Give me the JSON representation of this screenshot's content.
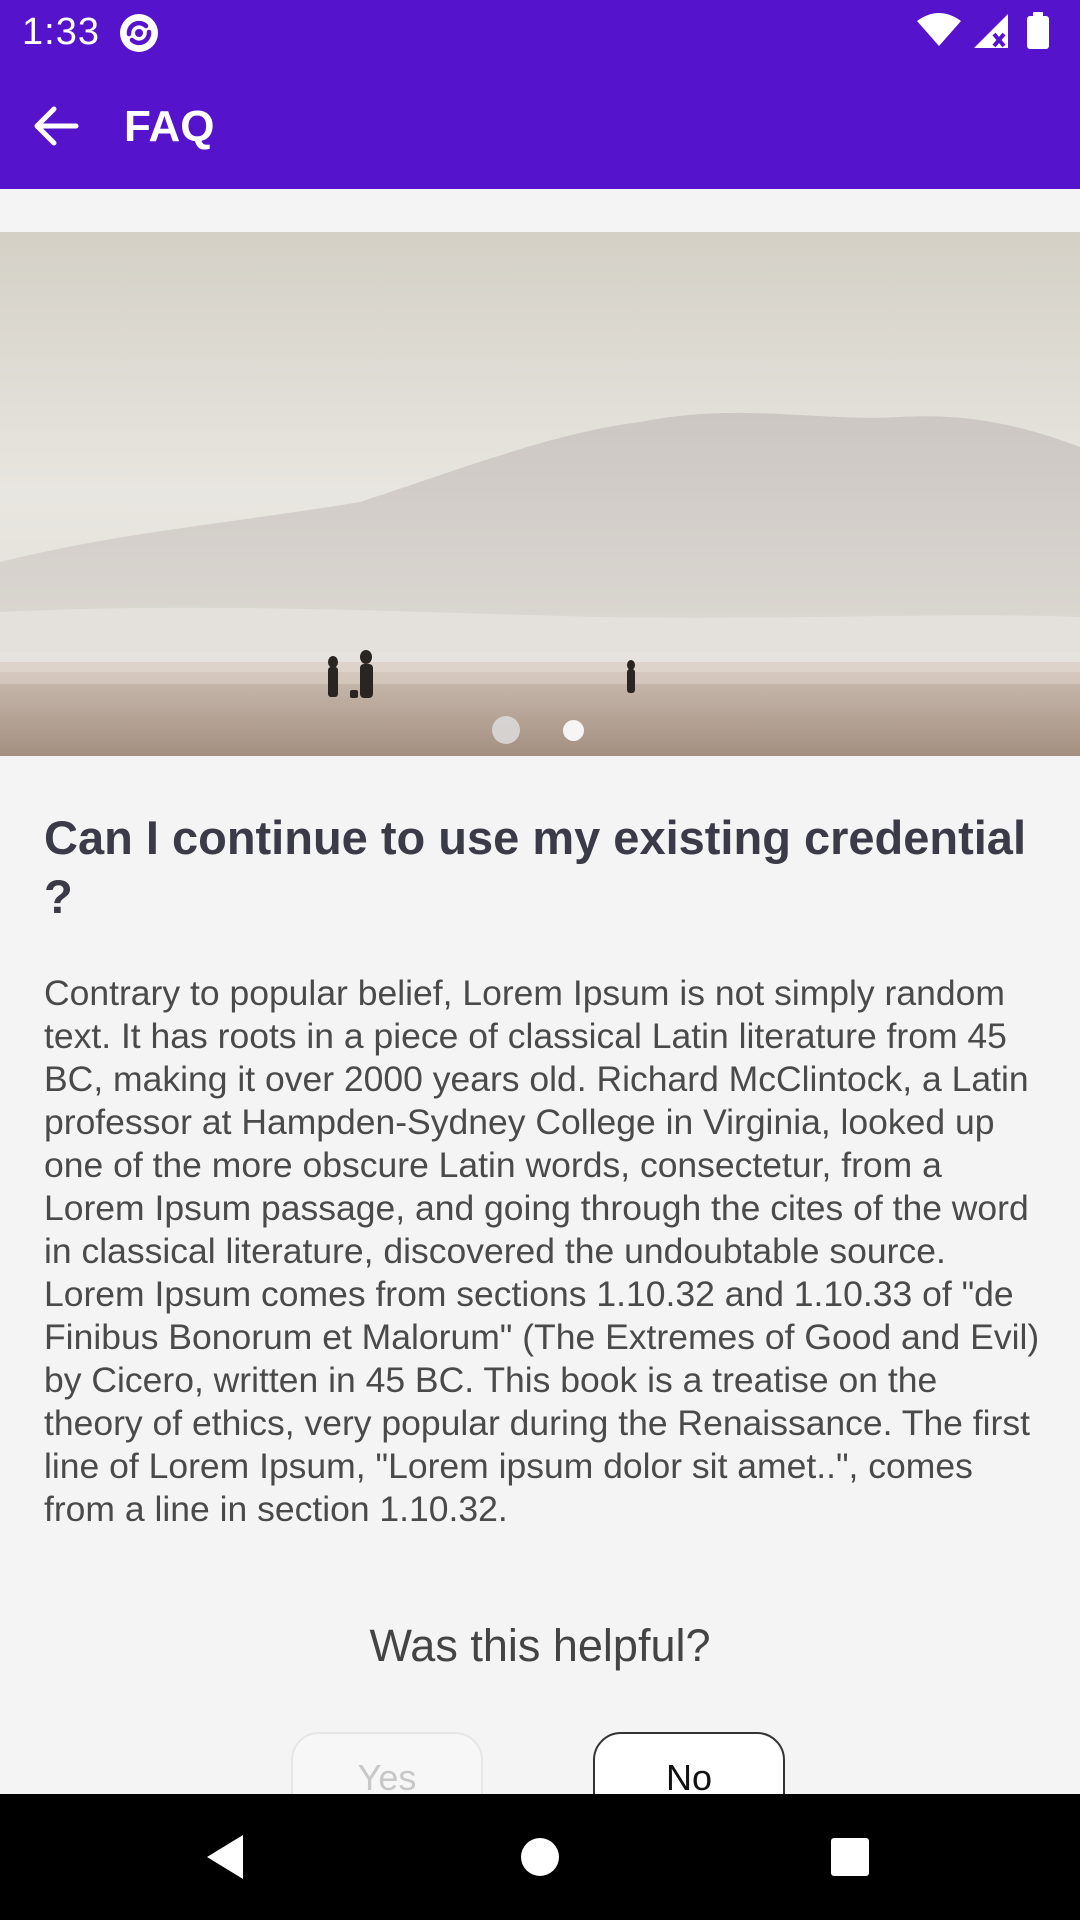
{
  "status_bar": {
    "time": "1:33",
    "icons": [
      "app-sync-icon",
      "wifi-icon",
      "cell-signal-icon",
      "battery-icon"
    ]
  },
  "app_bar": {
    "title": "FAQ",
    "back_icon": "arrow-left-icon",
    "background": "#5513cb"
  },
  "carousel": {
    "page_count": 2,
    "active_index": 0
  },
  "faq": {
    "question": "Can I continue to use my existing credential ?",
    "answer": "Contrary to popular belief, Lorem Ipsum is not simply random text. It has roots in a piece of classical Latin literature from 45 BC, making it over 2000 years old. Richard McClintock, a Latin professor at Hampden-Sydney College in Virginia, looked up one of the more obscure Latin words, consectetur, from a Lorem Ipsum passage, and going through the cites of the word in classical literature, discovered the undoubtable source. Lorem Ipsum comes from sections 1.10.32 and 1.10.33 of \"de Finibus Bonorum et Malorum\" (The Extremes of Good and Evil) by Cicero, written in 45 BC. This book is a treatise on the theory of ethics, very popular during the Renaissance. The first line of Lorem Ipsum, \"Lorem ipsum dolor sit amet..\", comes from a line in section 1.10.32."
  },
  "feedback": {
    "prompt": "Was this helpful?",
    "yes_label": "Yes",
    "no_label": "No"
  },
  "nav_bar": {
    "icons": [
      "back-triangle-icon",
      "home-circle-icon",
      "recents-square-icon"
    ]
  }
}
